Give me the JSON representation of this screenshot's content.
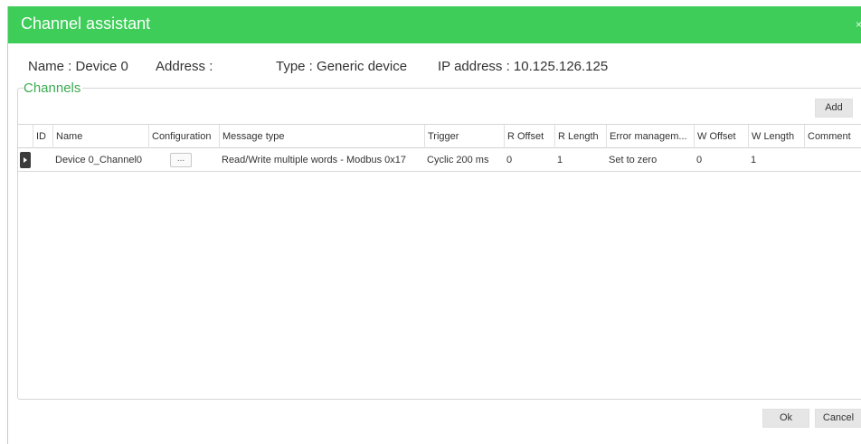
{
  "window": {
    "title": "Channel assistant",
    "close_glyph": "×"
  },
  "device_info": {
    "name": "Name : Device 0",
    "address": "Address :",
    "type": "Type : Generic device",
    "ip": "IP address : 10.125.126.125"
  },
  "channels": {
    "group_label": "Channels",
    "add_label": "Add",
    "columns": [
      "ID",
      "Name",
      "Configuration",
      "Message type",
      "Trigger",
      "R Offset",
      "R Length",
      "Error managem...",
      "W Offset",
      "W Length",
      "Comment"
    ],
    "rows": [
      {
        "id": "",
        "name": "Device 0_Channel0",
        "configuration": "...",
        "message_type": "Read/Write multiple words - Modbus 0x17",
        "trigger": "Cyclic 200 ms",
        "r_offset": "0",
        "r_length": "1",
        "error_management": "Set to zero",
        "w_offset": "0",
        "w_length": "1",
        "comment": ""
      }
    ]
  },
  "footer": {
    "ok_label": "Ok",
    "cancel_label": "Cancel"
  },
  "colors": {
    "accent": "#3dcd58",
    "group_label": "#3dab52"
  }
}
